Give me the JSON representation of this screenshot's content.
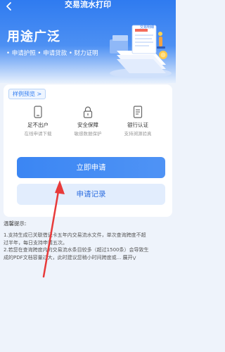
{
  "nav": {
    "title": "交易流水打印"
  },
  "hero": {
    "title": "用途广泛",
    "tags": "• 申请护照  • 申请贷款  • 财力证明",
    "art_label": "交易明细"
  },
  "card": {
    "sample_link": "样例预览 >",
    "features": [
      {
        "title": "足不出户",
        "desc": "在线申请下载"
      },
      {
        "title": "安全保障",
        "desc": "敏感数据保护"
      },
      {
        "title": "银行认证",
        "desc": "支持溯源验真"
      }
    ],
    "apply_button": "立即申请",
    "record_button": "申请记录"
  },
  "tips": {
    "title": "温馨提示:",
    "lines": [
      "1.支持生成已关联借记卡五年内交易流水文件，单次查询跨度不超",
      "过半年，每日支持申请五次。",
      "2.若您在查询跨度内的交易流水条目较多（超过1500条）会导致生",
      "成的PDF文档容量过大，此时建议您稍小时间跨度或..."
    ],
    "expand": "展开"
  },
  "colors": {
    "primary": "#2f7bf0",
    "annotation_arrow": "#e83a3a"
  }
}
